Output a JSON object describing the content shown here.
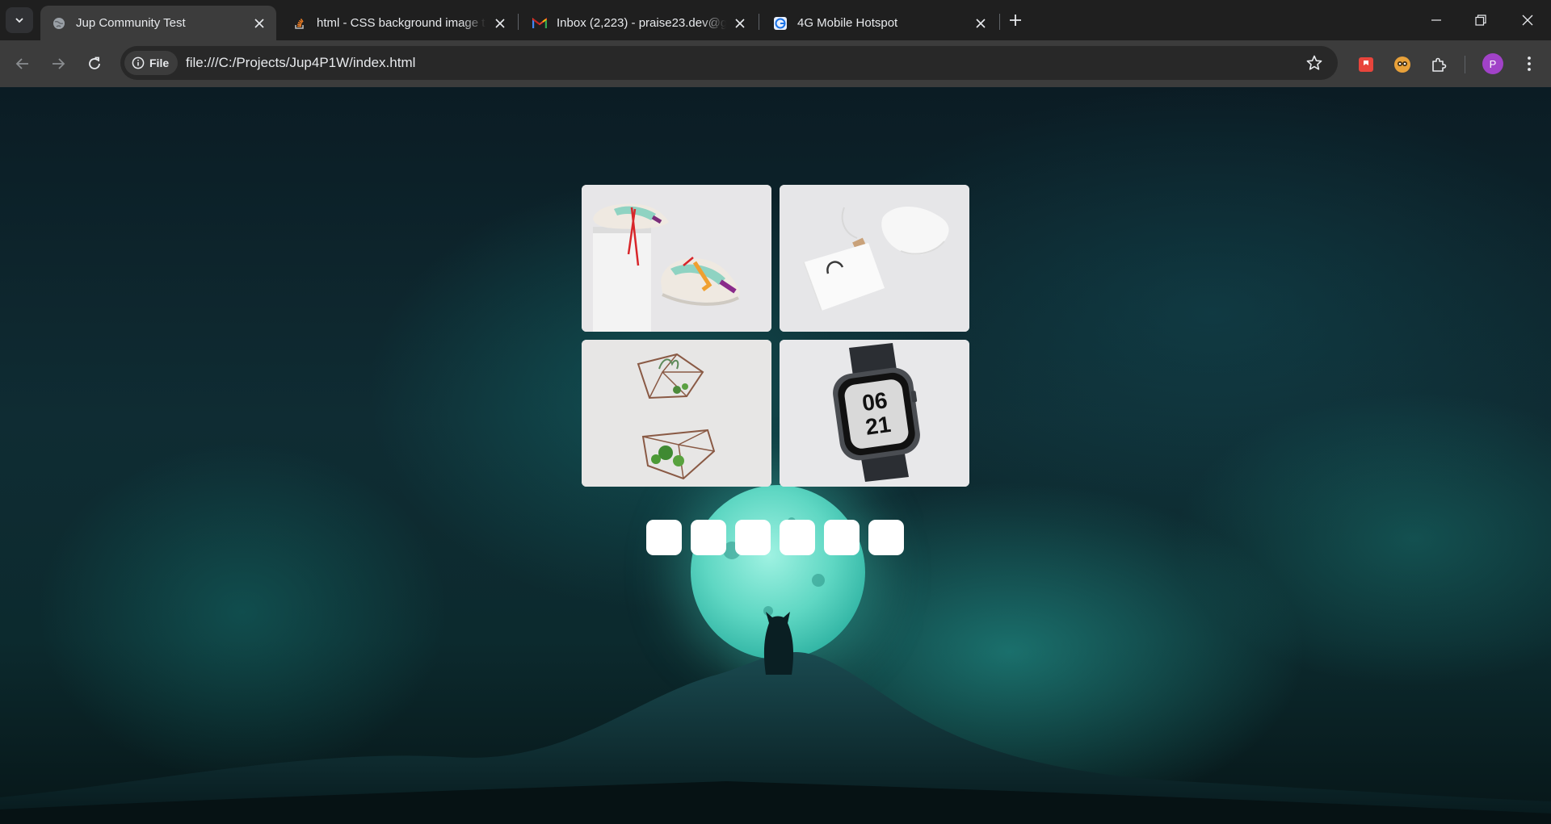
{
  "browser": {
    "tabs": [
      {
        "title": "Jup Community Test",
        "active": true,
        "favicon": "globe-icon"
      },
      {
        "title": "html - CSS background image t",
        "active": false,
        "favicon": "stackoverflow-icon"
      },
      {
        "title": "Inbox (2,223) - praise23.dev@g",
        "active": false,
        "favicon": "gmail-icon"
      },
      {
        "title": "4G Mobile Hotspot",
        "active": false,
        "favicon": "hotspot-icon"
      }
    ],
    "address_chip": "File",
    "url": "file:///C:/Projects/Jup4P1W/index.html",
    "profile_initial": "P",
    "accent_colors": {
      "profile": "#a142c8",
      "extension_red": "#e8453c",
      "extension_orange": "#e8a13a"
    }
  },
  "page": {
    "grid_items": [
      {
        "name": "sneakers-image",
        "alt_icon": "shoe-icon"
      },
      {
        "name": "bag-image",
        "alt_icon": "bag-icon"
      },
      {
        "name": "terrarium-image",
        "alt_icon": "plant-icon"
      },
      {
        "name": "watch-image",
        "alt_icon": "watch-icon",
        "watch_face": [
          "06",
          "21"
        ]
      }
    ],
    "slider_buttons_count": 6,
    "background_theme": "night sky with moon and cat silhouette"
  }
}
